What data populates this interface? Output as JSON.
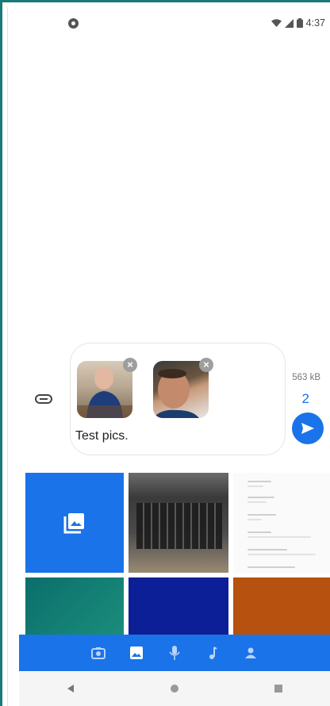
{
  "status_bar": {
    "time": "4:37"
  },
  "compose": {
    "attachment_size": "563 kB",
    "attachment_count": "2",
    "message_text": "Test pics."
  },
  "colors": {
    "accent": "#1a73e8",
    "frame": "#1a7a78"
  },
  "picker": {
    "tiles": [
      "gallery-icon",
      "keyboard-photo",
      "settings-screenshot",
      "teal-image",
      "navy-image",
      "orange-image"
    ]
  },
  "toolbar": {
    "icons": [
      "camera-icon",
      "gallery-icon",
      "mic-icon",
      "music-note-icon",
      "contact-icon"
    ],
    "active": "gallery-icon"
  },
  "navbar": {
    "icons": [
      "back-icon",
      "home-icon",
      "recents-icon"
    ]
  }
}
